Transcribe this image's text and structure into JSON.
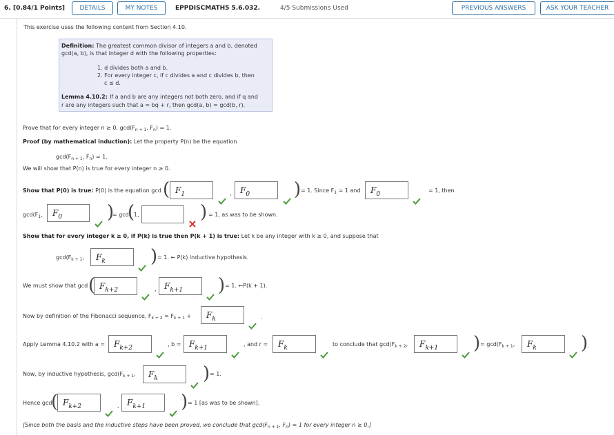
{
  "header": {
    "question_number": "6.",
    "points": "[0.84/1 Points]",
    "details_label": "DETAILS",
    "my_notes_label": "MY NOTES",
    "problem_id": "EPPDISCMATH5 5.6.032.",
    "submissions": "4/5 Submissions Used",
    "previous_answers_label": "PREVIOUS ANSWERS",
    "ask_teacher_label": "ASK YOUR TEACHER"
  },
  "intro": "This exercise uses the following content from Section 4.10.",
  "definition": {
    "label": "Definition:",
    "text1": "The greatest common divisor of integers a and b, denoted",
    "text2": "gcd(a, b), is that integer d with the following properties:",
    "item1": "1. d divides both a and b.",
    "item2": "2. For every integer c, if c divides a and c divides b, then",
    "item2b": "c ≤ d.",
    "lemma_label": "Lemma 4.10.2:",
    "lemma1": "If a and b are any integers not both zero, and if q and",
    "lemma2": "r are any integers such that a = bq + r, then gcd(a, b) = gcd(b, r)."
  },
  "prove_prefix": "Prove that for every integer n ≥ 0, gcd(F",
  "prove_suffix": ") = 1.",
  "proof_label": "Proof (by mathematical induction):",
  "proof_text": "Let the property P(n) be the equation",
  "eq_prefix": "gcd(F",
  "eq_suffix": ") = 1.",
  "show_text": "We will show that P(n) is true for every integer n ≥ 0.",
  "basis": {
    "label": "Show that P(0) is true:",
    "text": "P(0) is the equation gcd",
    "after": "= 1. Since F",
    "after2": "= 1 and",
    "then": "= 1, then",
    "ans1": "F",
    "ans1_sub": "1",
    "ans2": "F",
    "ans2_sub": "0",
    "ans3": "F",
    "ans3_sub": "0",
    "gcd2_prefix": "gcd",
    "ans4": "F",
    "ans4_sub": "0",
    "eq_gcd1": "= gcd",
    "one": "1,",
    "ans5": "",
    "shown": "= 1, as was to be shown."
  },
  "inductive": {
    "label": "Show that for every integer k ≥ 0, if P(k) is true then P(k + 1) is true:",
    "text": "Let k be any integer with k ≥ 0, and suppose that",
    "hyp_prefix": "gcd",
    "ansA": "F",
    "ansA_sub": "k",
    "hyp_suffix": "= 1.   ← P(k) inductive hypothesis.",
    "must": "We must show that gcd",
    "ansB": "F",
    "ansB_sub": "k+2",
    "ansC": "F",
    "ansC_sub": "k+1",
    "must_suffix": "= 1.   ←P(k + 1).",
    "fib_text": "Now by definition of the Fibonacci sequence, F",
    "ansD": "F",
    "ansD_sub": "k",
    "apply_text": "Apply Lemma 4.10.2 with a =",
    "ansE": "F",
    "ansE_sub": "k+2",
    "b_eq": ", b =",
    "ansF": "F",
    "ansF_sub": "k+1",
    "and_r": ", and r =",
    "ansG": "F",
    "ansG_sub": "k",
    "conclude": "to conclude that gcd",
    "ansH": "F",
    "ansH_sub": "k+1",
    "eq_gcd": "= gcd",
    "ansI": "F",
    "ansI_sub": "k",
    "now_hyp": "Now, by inductive hypothesis, gcd",
    "ansJ": "F",
    "ansJ_sub": "k",
    "eq1": "= 1.",
    "hence": "Hence gcd",
    "ansK": "F",
    "ansK_sub": "k+2",
    "ansL": "F",
    "ansL_sub": "k+1",
    "hence_suffix": "= 1 [as was to be shown].",
    "final": "[Since both the basis and the inductive steps have been proved, we conclude that gcd(F",
    "final2": ") = 1 for every integer n ≥ 0.]"
  },
  "colors": {
    "accent": "#2e6ea3",
    "check": "#4a9a3a",
    "cross": "#d9322a",
    "defbox": "#e9ecf7"
  }
}
